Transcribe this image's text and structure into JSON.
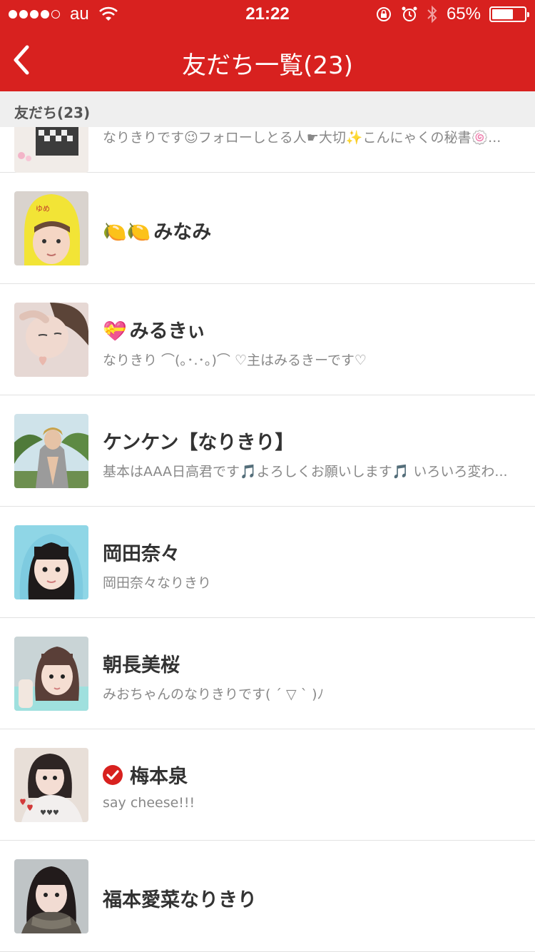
{
  "status_bar": {
    "carrier": "au",
    "time": "21:22",
    "battery": "65%",
    "battery_level": 0.65
  },
  "nav": {
    "title": "友だち一覧(23)"
  },
  "section": {
    "header": "友だち(23)"
  },
  "friends": [
    {
      "name": "",
      "desc": "なりきりです😉フォローしとる人☛大切✨こんにゃくの秘書🍥..."
    },
    {
      "prefix": "🍋🍋",
      "name": "みなみ",
      "desc": ""
    },
    {
      "prefix": "💝",
      "name": "みるきぃ",
      "desc": "なりきり ⌒(｡･.･｡)⌒ ♡主はみるきーです♡"
    },
    {
      "name": "ケンケン【なりきり】",
      "desc": "基本はAAA日高君です🎵よろしくお願いします🎵 いろいろ変わ..."
    },
    {
      "name": "岡田奈々",
      "desc": "岡田奈々なりきり"
    },
    {
      "name": "朝長美桜",
      "desc": "みおちゃんのなりきりです( ´ ▽ ` )ﾉ"
    },
    {
      "name": "梅本泉",
      "desc": "say  cheese!!!",
      "verified": true
    },
    {
      "name": "福本愛菜なりきり",
      "desc": ""
    }
  ],
  "colors": {
    "accent": "#d8211f",
    "section_bg": "#efefef"
  }
}
